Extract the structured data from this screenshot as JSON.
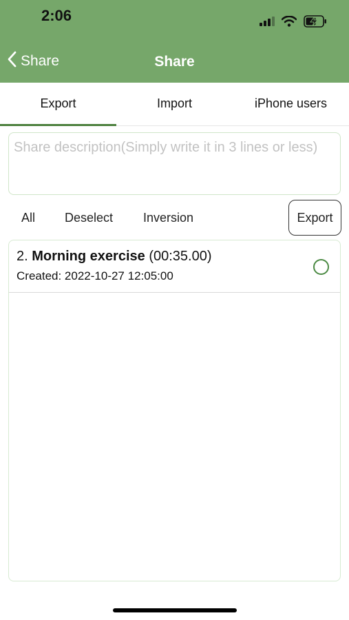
{
  "status_bar": {
    "time": "2:06",
    "icons": [
      "signal-icon",
      "wifi-icon",
      "battery-charging-icon"
    ]
  },
  "nav": {
    "back_label": "Share",
    "title": "Share"
  },
  "tabs": [
    {
      "label": "Export",
      "active": true
    },
    {
      "label": "Import",
      "active": false
    },
    {
      "label": "iPhone users",
      "active": false
    }
  ],
  "description": {
    "placeholder": "Share description(Simply write it in 3 lines or less)",
    "value": ""
  },
  "actions": {
    "all_label": "All",
    "deselect_label": "Deselect",
    "inversion_label": "Inversion",
    "export_label": "Export"
  },
  "items": [
    {
      "index": "2.",
      "name": "Morning exercise",
      "duration": "(00:35.00)",
      "created": "Created: 2022-10-27 12:05:00",
      "selected": false
    }
  ],
  "colors": {
    "header_bg": "#76a76a",
    "accent": "#4b7f3c",
    "radio": "#4b8a43"
  }
}
